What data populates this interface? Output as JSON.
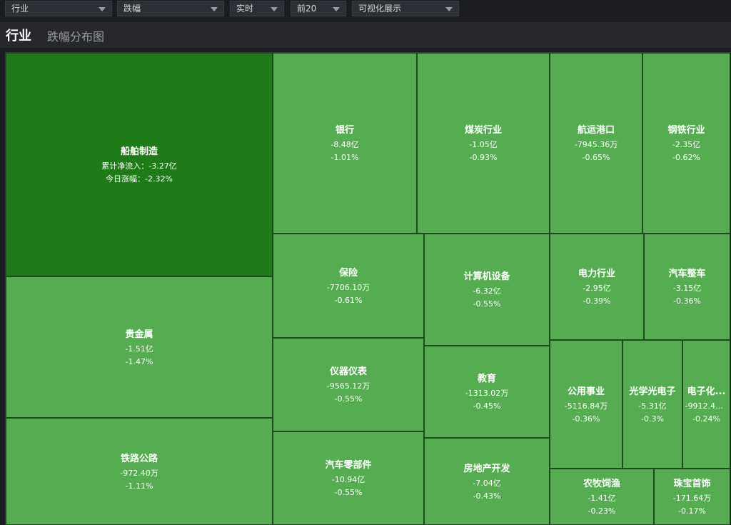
{
  "filters": [
    {
      "label": "行业"
    },
    {
      "label": "跌幅"
    },
    {
      "label": "实时"
    },
    {
      "label": "前20"
    },
    {
      "label": "可视化展示"
    }
  ],
  "title": {
    "main": "行业",
    "sub": "跌幅分布图"
  },
  "colors": {
    "cell_default": "#55ac51",
    "cell_highlight": "#1f7b17",
    "border": "#1f4a1f"
  },
  "chart_data": {
    "type": "treemap",
    "items": [
      {
        "name": "船舶制造",
        "flow": "累计净流入：-3.27亿",
        "change": "今日涨幅：-2.32%"
      },
      {
        "name": "贵金属",
        "flow": "-1.51亿",
        "change": "-1.47%"
      },
      {
        "name": "铁路公路",
        "flow": "-972.40万",
        "change": "-1.11%"
      },
      {
        "name": "银行",
        "flow": "-8.48亿",
        "change": "-1.01%"
      },
      {
        "name": "煤炭行业",
        "flow": "-1.05亿",
        "change": "-0.93%"
      },
      {
        "name": "航运港口",
        "flow": "-7945.36万",
        "change": "-0.65%"
      },
      {
        "name": "钢铁行业",
        "flow": "-2.35亿",
        "change": "-0.62%"
      },
      {
        "name": "保险",
        "flow": "-7706.10万",
        "change": "-0.61%"
      },
      {
        "name": "计算机设备",
        "flow": "-6.32亿",
        "change": "-0.55%"
      },
      {
        "name": "电力行业",
        "flow": "-2.95亿",
        "change": "-0.39%"
      },
      {
        "name": "汽车整车",
        "flow": "-3.15亿",
        "change": "-0.36%"
      },
      {
        "name": "仪器仪表",
        "flow": "-9565.12万",
        "change": "-0.55%"
      },
      {
        "name": "教育",
        "flow": "-1313.02万",
        "change": "-0.45%"
      },
      {
        "name": "公用事业",
        "flow": "-5116.84万",
        "change": "-0.36%"
      },
      {
        "name": "光学光电子",
        "flow": "-5.31亿",
        "change": "-0.3%"
      },
      {
        "name": "电子化...",
        "flow": "-9912.43...",
        "change": "-0.24%"
      },
      {
        "name": "汽车零部件",
        "flow": "-10.94亿",
        "change": "-0.55%"
      },
      {
        "name": "房地产开发",
        "flow": "-7.04亿",
        "change": "-0.43%"
      },
      {
        "name": "农牧饲渔",
        "flow": "-1.41亿",
        "change": "-0.23%"
      },
      {
        "name": "珠宝首饰",
        "flow": "-171.64万",
        "change": "-0.17%"
      }
    ]
  }
}
